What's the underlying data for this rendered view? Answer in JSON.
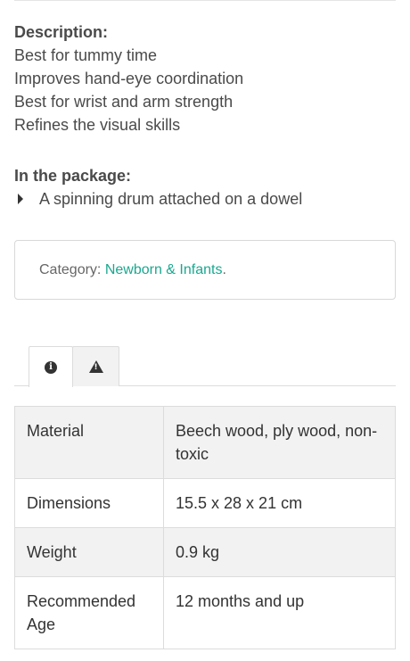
{
  "description": {
    "title": "Description:",
    "lines": [
      "Best for tummy time",
      "Improves hand-eye coordination",
      "Best for wrist and arm strength",
      "Refines the visual skills"
    ]
  },
  "package": {
    "title": "In the package:",
    "items": [
      "A spinning drum attached on a dowel"
    ]
  },
  "category": {
    "label": "Category:",
    "link": "Newborn & Infants",
    "suffix": "."
  },
  "tabs": [
    {
      "icon": "info-icon",
      "active": true
    },
    {
      "icon": "warning-icon",
      "active": false
    }
  ],
  "specs": [
    {
      "key": "Material",
      "value": "Beech wood, ply wood, non-toxic"
    },
    {
      "key": "Dimensions",
      "value": "15.5 x 28 x 21 cm"
    },
    {
      "key": "Weight",
      "value": "0.9 kg"
    },
    {
      "key": "Recommended Age",
      "value": "12 months and up"
    }
  ],
  "colors": {
    "link": "#1aa88f",
    "text": "#4a4a4a",
    "row_shade": "#f2f2f2",
    "border": "#dcdcdc"
  }
}
